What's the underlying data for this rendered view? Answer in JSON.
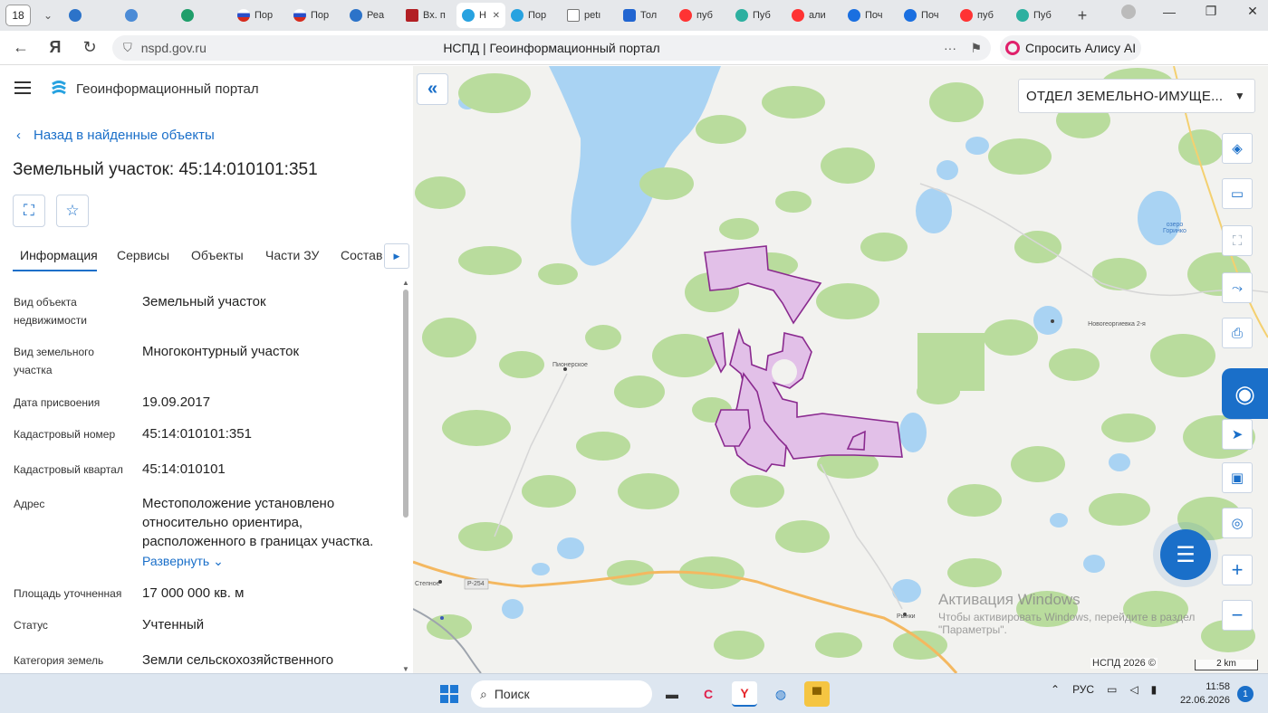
{
  "browser": {
    "tab_count": "18",
    "tabs": [
      "Пор",
      "Пор",
      "Реа",
      "Вх. п",
      "Н",
      "Пор",
      "petı",
      "Тол",
      "пуб",
      "Пуб",
      "али",
      "Поч",
      "Поч",
      "пуб",
      "Пуб"
    ],
    "url": "nspd.gov.ru",
    "page_title": "НСПД | Геоинформационный портал",
    "alice_label": "Спросить Алису AI"
  },
  "sidebar": {
    "portal_title": "Геоинформационный портал",
    "back_label": "Назад в найденные объекты",
    "object_title": "Земельный участок: 45:14:010101:351",
    "tabs": [
      "Информация",
      "Сервисы",
      "Объекты",
      "Части ЗУ",
      "Состав"
    ],
    "fields": [
      {
        "label": "Вид объекта недвижимости",
        "value": "Земельный участок"
      },
      {
        "label": "Вид земельного участка",
        "value": "Многоконтурный участок"
      },
      {
        "label": "Дата присвоения",
        "value": "19.09.2017"
      },
      {
        "label": "Кадастровый номер",
        "value": "45:14:010101:351"
      },
      {
        "label": "Кадастровый квартал",
        "value": "45:14:010101"
      },
      {
        "label": "Адрес",
        "value": "Местоположение установлено относительно ориентира, расположенного в границах участка."
      },
      {
        "label": "Площадь уточненная",
        "value": "17 000 000 кв. м"
      },
      {
        "label": "Статус",
        "value": "Учтенный"
      },
      {
        "label": "Категория земель",
        "value": "Земли сельскохозяйственного"
      }
    ],
    "expand_label": "Развернуть"
  },
  "map": {
    "dept_select": "ОТДЕЛ ЗЕМЕЛЬНО-ИМУЩЕ...",
    "labels": {
      "lake": "озеро Горинко",
      "village1": "Новогеоргиевка 2-я",
      "village2": "Пионерское",
      "village3": "Степное",
      "village4": "Рынки",
      "road": "Р-254"
    },
    "watermark": [
      "Активация Windows",
      "Чтобы активировать Windows, перейдите в раздел",
      "\"Параметры\"."
    ],
    "copyright": "НСПД 2026 ©",
    "scale": "2 km"
  },
  "taskbar": {
    "search_placeholder": "Поиск",
    "lang": "РУС",
    "time": "11:58",
    "date": "22.06.2026",
    "notifications": "1"
  }
}
